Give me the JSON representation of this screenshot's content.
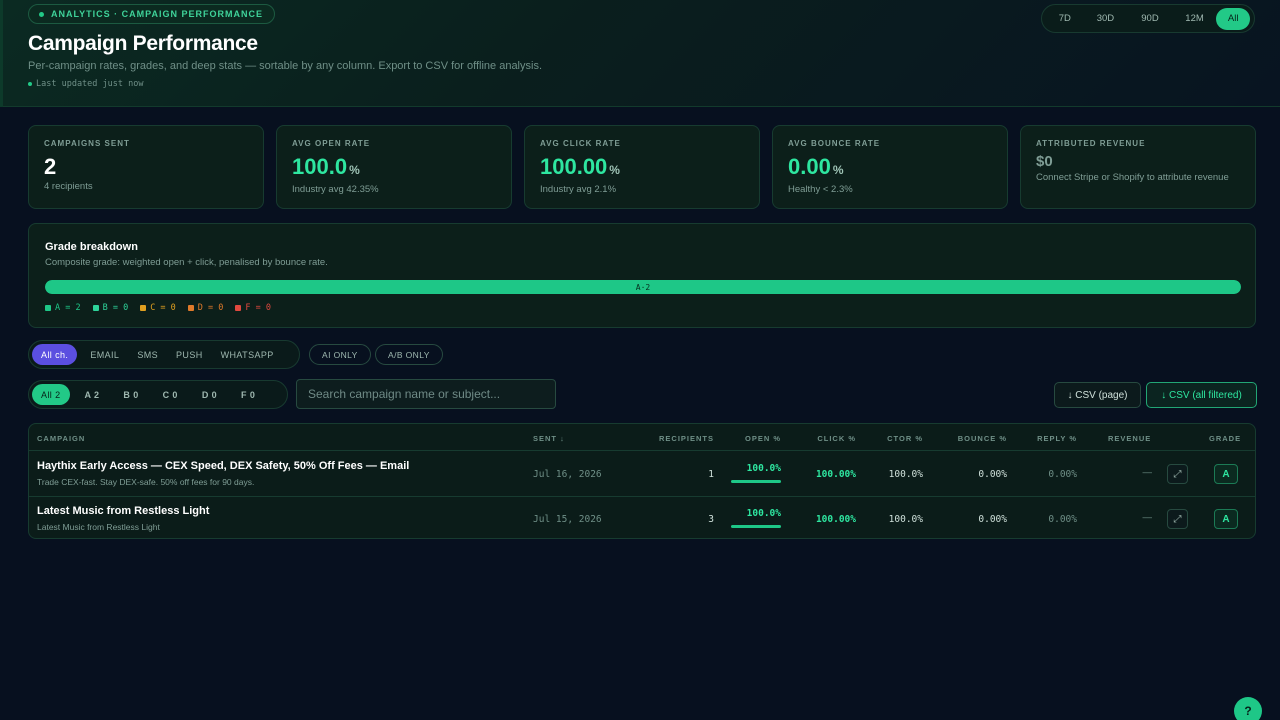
{
  "header": {
    "tag": "ANALYTICS · CAMPAIGN PERFORMANCE",
    "title": "Campaign Performance",
    "subtitle": "Per-campaign rates, grades, and deep stats — sortable by any column. Export to CSV for offline analysis.",
    "updated": "Last updated just now",
    "ranges": [
      "7D",
      "30D",
      "90D",
      "12M",
      "All"
    ],
    "active_range": "All"
  },
  "kpis": [
    {
      "label": "CAMPAIGNS SENT",
      "value": "2",
      "unit": "",
      "sub": "4 recipients"
    },
    {
      "label": "AVG OPEN RATE",
      "value": "100.0",
      "unit": "%",
      "sub": "Industry avg 42.35%"
    },
    {
      "label": "AVG CLICK RATE",
      "value": "100.00",
      "unit": "%",
      "sub": "Industry avg 2.1%"
    },
    {
      "label": "AVG BOUNCE RATE",
      "value": "0.00",
      "unit": "%",
      "sub": "Healthy < 2.3%"
    },
    {
      "label": "ATTRIBUTED REVENUE",
      "value": "$0",
      "unit": "",
      "sub": "Connect Stripe or Shopify to attribute revenue"
    }
  ],
  "grades": {
    "title": "Grade breakdown",
    "subtitle": "Composite grade: weighted open + click, penalised by bounce rate.",
    "bar_label": "A·2",
    "bar_fraction": 1.0,
    "legend": [
      {
        "label": "A = 2",
        "color": "#1ec787"
      },
      {
        "label": "B = 0",
        "color": "#2ed39a"
      },
      {
        "label": "C = 0",
        "color": "#e0a020"
      },
      {
        "label": "D = 0",
        "color": "#e07a2a"
      },
      {
        "label": "F = 0",
        "color": "#e0493f"
      }
    ]
  },
  "channels": [
    "All ch.",
    "EMAIL",
    "SMS",
    "PUSH",
    "WHATSAPP"
  ],
  "active_channel": "All ch.",
  "toggles": {
    "ai_only": "AI ONLY",
    "ab_only": "A/B ONLY"
  },
  "grade_filters": [
    "All 2",
    "A 2",
    "B 0",
    "C 0",
    "D 0",
    "F 0"
  ],
  "active_grade_filter": "All 2",
  "search": {
    "placeholder": "Search campaign name or subject..."
  },
  "export": {
    "page": "↓ CSV (page)",
    "all": "↓ CSV (all filtered)"
  },
  "table": {
    "columns": {
      "campaign": "CAMPAIGN",
      "sent": "SENT ↓",
      "recipients": "RECIPIENTS",
      "open": "OPEN %",
      "click": "CLICK %",
      "ctor": "CTOR %",
      "bounce": "BOUNCE %",
      "reply": "REPLY %",
      "revenue": "REVENUE",
      "grade": "GRADE"
    },
    "rows": [
      {
        "name": "Haythix Early Access — CEX Speed, DEX Safety, 50% Off Fees — Email",
        "subject": "Trade CEX-fast. Stay DEX-safe. 50% off fees for 90 days.",
        "sent": "Jul 16, 2026",
        "recipients": "1",
        "open": "100.0%",
        "click": "100.00%",
        "ctor": "100.0%",
        "bounce": "0.00%",
        "reply": "0.00%",
        "revenue": "—",
        "grade": "A"
      },
      {
        "name": "Latest Music from Restless Light",
        "subject": "Latest Music from Restless Light",
        "sent": "Jul 15, 2026",
        "recipients": "3",
        "open": "100.0%",
        "click": "100.00%",
        "ctor": "100.0%",
        "bounce": "0.00%",
        "reply": "0.00%",
        "revenue": "—",
        "grade": "A"
      }
    ]
  },
  "help_label": "?"
}
